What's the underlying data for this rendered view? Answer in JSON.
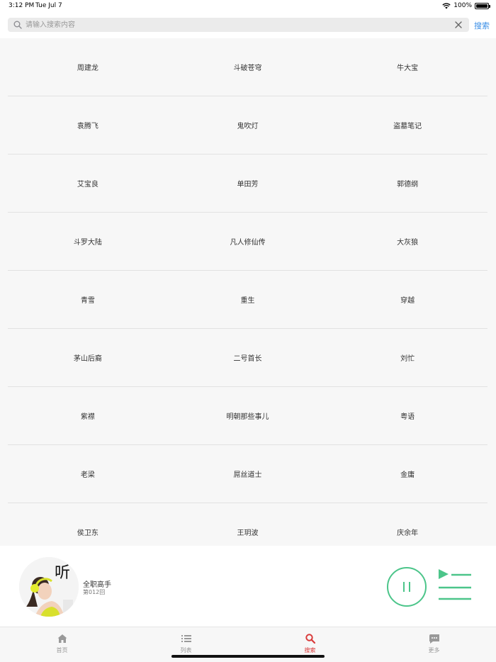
{
  "status_bar": {
    "time": "3:12 PM",
    "date": "Tue Jul 7",
    "battery_text": "100%",
    "battery_level": 1.0
  },
  "search": {
    "placeholder": "请输入搜索内容",
    "value": "",
    "button_label": "搜索"
  },
  "keywords": [
    [
      "周建龙",
      "斗破苍穹",
      "牛大宝"
    ],
    [
      "袁腾飞",
      "鬼吹灯",
      "盗墓笔记"
    ],
    [
      "艾宝良",
      "单田芳",
      "郭德纲"
    ],
    [
      "斗罗大陆",
      "凡人修仙传",
      "大灰狼"
    ],
    [
      "青雪",
      "重生",
      "穿越"
    ],
    [
      "茅山后裔",
      "二号首长",
      "刘忙"
    ],
    [
      "紫襟",
      "明朝那些事儿",
      "粤语"
    ],
    [
      "老梁",
      "屌丝道士",
      "金庸"
    ],
    [
      "侯卫东",
      "王玥波",
      "庆余年"
    ]
  ],
  "player": {
    "cover_text": "听",
    "title": "全职高手",
    "episode": "第012回"
  },
  "tabs": [
    {
      "label": "首页",
      "icon": "home-icon",
      "active": false
    },
    {
      "label": "列表",
      "icon": "list-icon",
      "active": false
    },
    {
      "label": "搜索",
      "icon": "search-icon",
      "active": true
    },
    {
      "label": "更多",
      "icon": "more-icon",
      "active": false
    }
  ],
  "colors": {
    "accent": "#3a8ee6",
    "player_green": "#4cc58a",
    "tab_active": "#d93b3b",
    "tab_inactive": "#999999"
  }
}
